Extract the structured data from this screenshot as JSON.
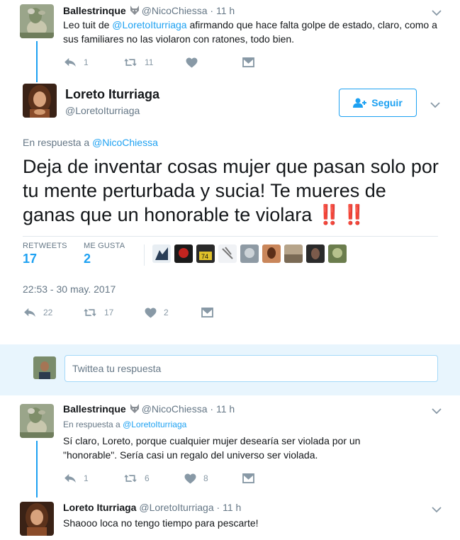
{
  "tweet1": {
    "author_name": "Ballestrinque",
    "author_handle": "@NicoChiessa",
    "time": "11 h",
    "text_before": "Leo tuit de ",
    "mention": "@LoretoIturriaga",
    "text_after": " afirmando que hace falta golpe de estado, claro, como a sus familiares no las violaron con ratones, todo bien.",
    "replies": "1",
    "retweets": "11"
  },
  "main_tweet": {
    "author_name": "Loreto Iturriaga",
    "author_handle": "@LoretoIturriaga",
    "follow_label": "Seguir",
    "reply_prefix": "En respuesta a ",
    "reply_mention": "@NicoChiessa",
    "text": "Deja de inventar cosas mujer que pasan solo por tu mente perturbada y sucia! Te mueres de ganas que un honorable te violara ",
    "emphasis": "‼️ ‼️",
    "retweets_label": "RETWEETS",
    "retweets_count": "17",
    "likes_label": "ME GUSTA",
    "likes_count": "2",
    "timestamp": "22:53 - 30 may. 2017",
    "actions": {
      "replies": "22",
      "retweets": "17",
      "likes": "2"
    }
  },
  "reply_box": {
    "placeholder": "Twittea tu respuesta"
  },
  "tweet3": {
    "author_name": "Ballestrinque",
    "author_handle": "@NicoChiessa",
    "time": "11 h",
    "reply_prefix": "En respuesta a ",
    "reply_mention": "@LoretoIturriaga",
    "text": "Sí claro, Loreto, porque cualquier mujer desearía ser violada por un \"honorable\". Sería casi un regalo del universo ser violada.",
    "replies": "1",
    "retweets": "6",
    "likes": "8"
  },
  "tweet4": {
    "author_name": "Loreto Iturriaga",
    "author_handle": "@LoretoIturriaga",
    "time": "11 h",
    "text": "Shaooo loca no tengo tiempo para pescarte!"
  },
  "colors": {
    "accent": "#1da1f2",
    "muted": "#657786",
    "icon": "#8899a6",
    "text": "#14171a",
    "emphasis": "#e0245e"
  }
}
